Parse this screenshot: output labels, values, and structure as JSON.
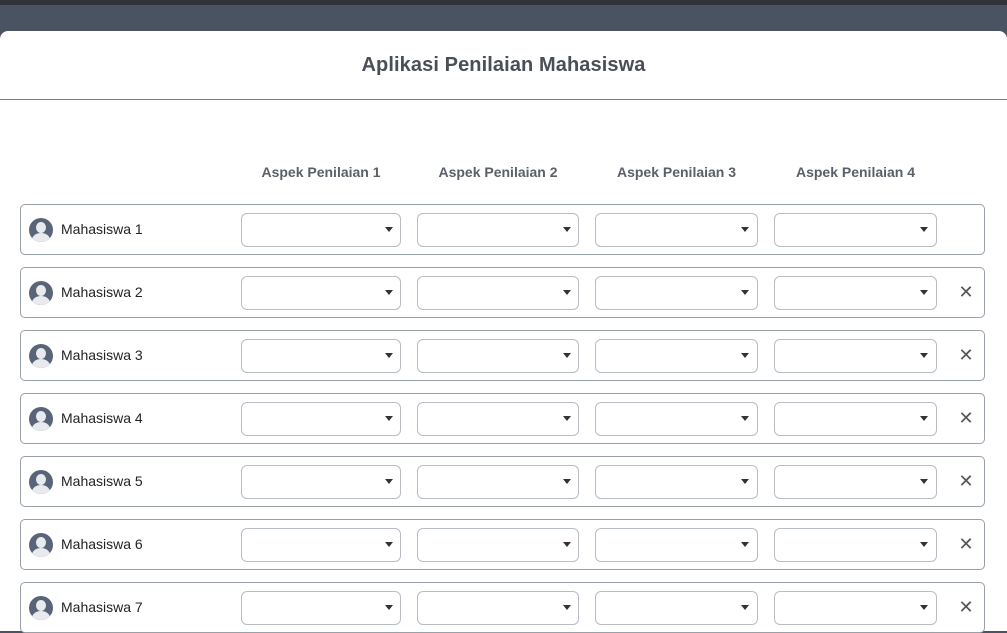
{
  "app": {
    "title": "Aplikasi Penilaian Mahasiswa"
  },
  "columns": [
    "Aspek Penilaian 1",
    "Aspek Penilaian 2",
    "Aspek Penilaian 3",
    "Aspek Penilaian 4"
  ],
  "students": [
    {
      "name": "Mahasiswa 1",
      "removable": false,
      "scores": [
        "",
        "",
        "",
        ""
      ]
    },
    {
      "name": "Mahasiswa 2",
      "removable": true,
      "scores": [
        "",
        "",
        "",
        ""
      ]
    },
    {
      "name": "Mahasiswa 3",
      "removable": true,
      "scores": [
        "",
        "",
        "",
        ""
      ]
    },
    {
      "name": "Mahasiswa 4",
      "removable": true,
      "scores": [
        "",
        "",
        "",
        ""
      ]
    },
    {
      "name": "Mahasiswa 5",
      "removable": true,
      "scores": [
        "",
        "",
        "",
        ""
      ]
    },
    {
      "name": "Mahasiswa 6",
      "removable": true,
      "scores": [
        "",
        "",
        "",
        ""
      ]
    },
    {
      "name": "Mahasiswa 7",
      "removable": true,
      "scores": [
        "",
        "",
        "",
        ""
      ]
    }
  ],
  "icons": {
    "avatar": "user-avatar-icon",
    "remove": "close-icon",
    "dropdown": "caret-down-icon"
  },
  "remove_glyph": "✕",
  "colors": {
    "background": "#4a5362",
    "card": "#ffffff",
    "border": "#9aa0a8"
  }
}
